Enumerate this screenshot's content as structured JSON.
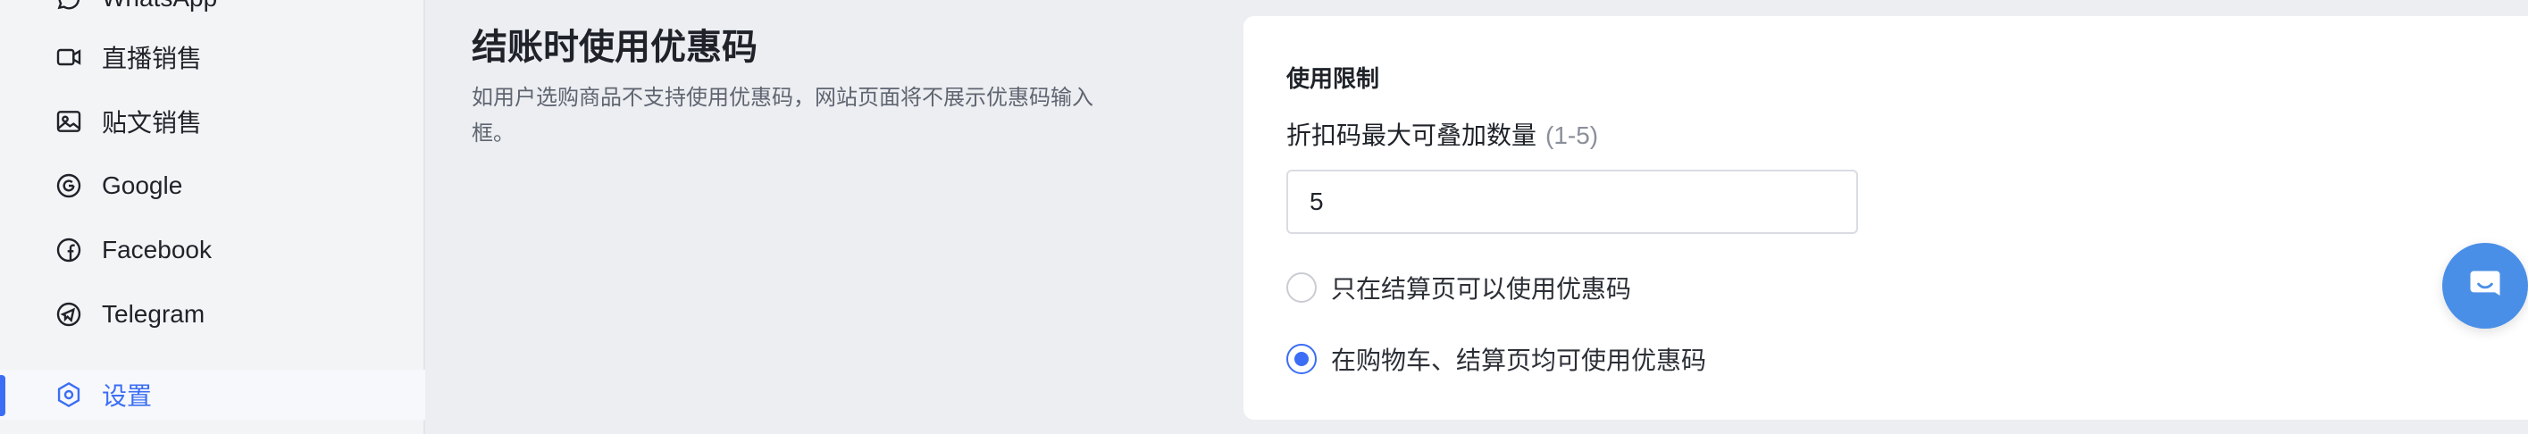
{
  "sidebar": {
    "items": [
      {
        "label": "WhatsApp",
        "icon": "whatsapp-icon"
      },
      {
        "label": "直播销售",
        "icon": "video-camera-icon"
      },
      {
        "label": "贴文销售",
        "icon": "image-post-icon"
      },
      {
        "label": "Google",
        "icon": "google-icon"
      },
      {
        "label": "Facebook",
        "icon": "facebook-icon"
      },
      {
        "label": "Telegram",
        "icon": "telegram-icon"
      },
      {
        "label": "设置",
        "icon": "settings-hex-icon",
        "active": true
      }
    ]
  },
  "section": {
    "title": "结账时使用优惠码",
    "description": "如用户选购商品不支持使用优惠码，网站页面将不展示优惠码输入框。"
  },
  "card": {
    "title": "使用限制",
    "stack_label": "折扣码最大可叠加数量",
    "stack_hint": "(1-5)",
    "stack_value": "5",
    "options": [
      {
        "label": "只在结算页可以使用优惠码",
        "selected": false
      },
      {
        "label": "在购物车、结算页均可使用优惠码",
        "selected": true
      }
    ]
  },
  "colors": {
    "accent": "#3b6ef5",
    "chat_button": "#4a8fe7",
    "page_bg": "#eceef2"
  },
  "chat": {
    "icon": "chat-bubble-icon"
  }
}
